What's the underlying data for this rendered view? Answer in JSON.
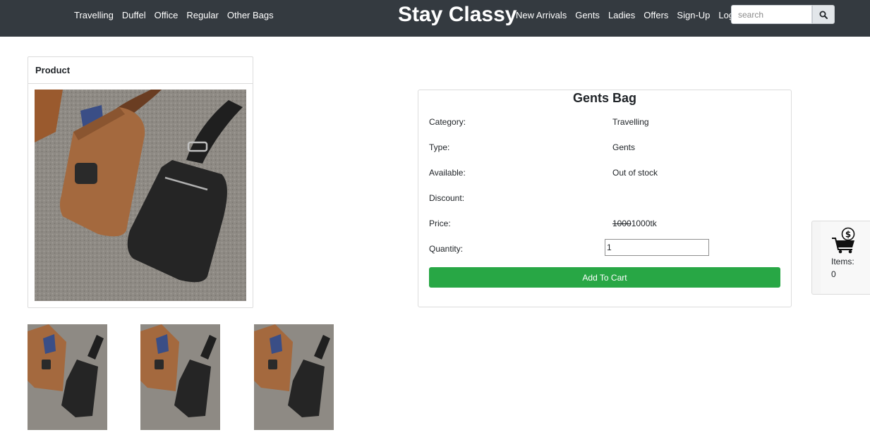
{
  "nav": {
    "left_links": [
      "Travelling",
      "Duffel",
      "Office",
      "Regular",
      "Other Bags"
    ],
    "brand": "Stay Classy",
    "right_links": [
      "New Arrivals",
      "Gents",
      "Ladies",
      "Offers",
      "Sign-Up",
      "Log-in"
    ],
    "search_placeholder": "search",
    "search_icon": "search-icon"
  },
  "product_card": {
    "header": "Product"
  },
  "detail": {
    "title": "Gents Bag",
    "category_label": "Category:",
    "category_value": "Travelling",
    "type_label": "Type:",
    "type_value": "Gents",
    "available_label": "Available:",
    "available_value": "Out of stock",
    "discount_label": "Discount:",
    "discount_value": "",
    "price_label": "Price:",
    "old_price": "1000",
    "new_price": "1000tk",
    "quantity_label": "Quantity:",
    "quantity_value": "1",
    "add_to_cart_label": "Add To Cart"
  },
  "cart": {
    "icon": "cart-icon",
    "items_label": "Items:",
    "items_count": "0"
  },
  "colors": {
    "navbar": "#343a40",
    "accent_green": "#28a745"
  }
}
